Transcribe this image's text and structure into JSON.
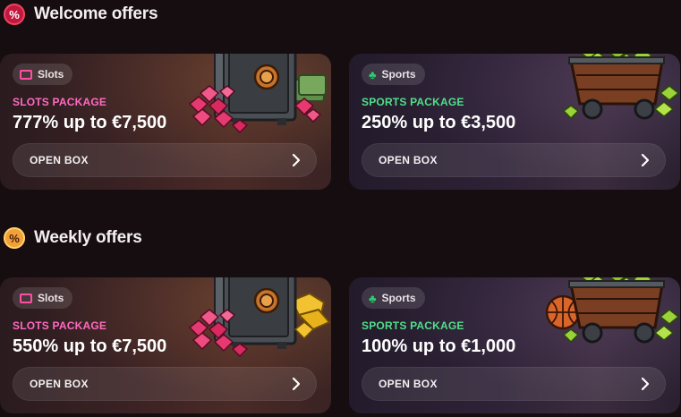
{
  "sections": [
    {
      "title": "Welcome offers",
      "badge": "%",
      "cards": [
        {
          "tag": "Slots",
          "package": "SLOTS PACKAGE",
          "amount": "777% up to €7,500",
          "button": "OPEN BOX",
          "icon": "slot-machine-icon"
        },
        {
          "tag": "Sports",
          "package": "SPORTS PACKAGE",
          "amount": "250% up to €3,500",
          "button": "OPEN BOX",
          "icon": "clover-icon"
        }
      ]
    },
    {
      "title": "Weekly offers",
      "badge": "%",
      "cards": [
        {
          "tag": "Slots",
          "package": "SLOTS PACKAGE",
          "amount": "550% up to €7,500",
          "button": "OPEN BOX",
          "icon": "slot-machine-icon"
        },
        {
          "tag": "Sports",
          "package": "SPORTS PACKAGE",
          "amount": "100% up to €1,000",
          "button": "OPEN BOX",
          "icon": "clover-icon"
        }
      ]
    }
  ],
  "colors": {
    "slots_accent": "#ff6ac1",
    "sports_accent": "#4fe08a",
    "welcome_badge": "#c2183f",
    "weekly_badge": "#f0a13a"
  }
}
